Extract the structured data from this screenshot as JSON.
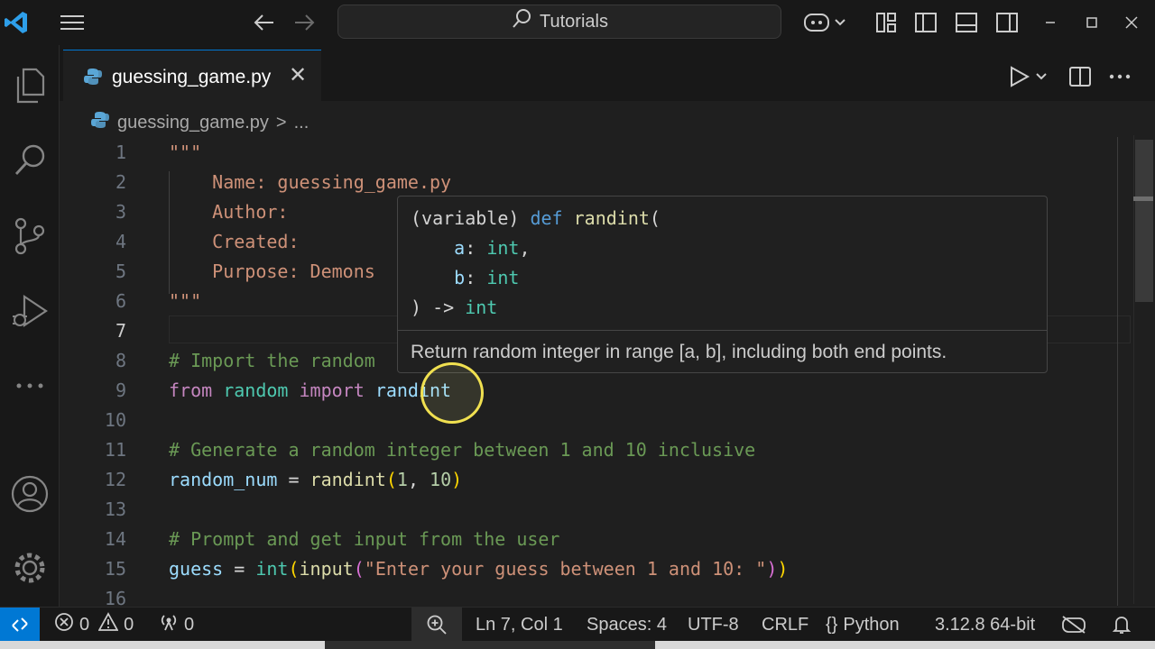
{
  "titlebar": {
    "search_label": "Tutorials",
    "icons": [
      "vscode-logo-icon",
      "menu-icon",
      "back-icon",
      "forward-icon",
      "copilot-icon",
      "layout-icon",
      "toggle-sidebar-icon",
      "toggle-panel-icon",
      "toggle-secondary-sidebar-icon",
      "minimize-icon",
      "maximize-icon",
      "close-icon"
    ]
  },
  "activitybar": {
    "items": [
      "explorer-icon",
      "search-icon",
      "source-control-icon",
      "run-debug-icon",
      "more-icon",
      "accounts-icon",
      "manage-gear-icon"
    ]
  },
  "tab": {
    "filename": "guessing_game.py",
    "close_glyph": "✕"
  },
  "breadcrumb": {
    "file": "guessing_game.py",
    "sep": ">",
    "rest": "..."
  },
  "editor": {
    "active_line": 7,
    "lines": [
      {
        "n": "1",
        "parts": [
          {
            "t": "\"\"\"",
            "c": "str"
          }
        ]
      },
      {
        "n": "2",
        "parts": [
          {
            "t": "    Name: guessing_game.py",
            "c": "str"
          }
        ]
      },
      {
        "n": "3",
        "parts": [
          {
            "t": "    Author:",
            "c": "str"
          }
        ]
      },
      {
        "n": "4",
        "parts": [
          {
            "t": "    Created:",
            "c": "str"
          }
        ]
      },
      {
        "n": "5",
        "parts": [
          {
            "t": "    Purpose: Demons",
            "c": "str"
          }
        ]
      },
      {
        "n": "6",
        "parts": [
          {
            "t": "\"\"\"",
            "c": "str"
          }
        ]
      },
      {
        "n": "7",
        "parts": []
      },
      {
        "n": "8",
        "parts": [
          {
            "t": "# Import the random",
            "c": "com"
          }
        ]
      },
      {
        "n": "9",
        "parts": [
          {
            "t": "from",
            "c": "kw"
          },
          {
            "t": " ",
            "c": "op"
          },
          {
            "t": "random",
            "c": "mod"
          },
          {
            "t": " ",
            "c": "op"
          },
          {
            "t": "import",
            "c": "kw"
          },
          {
            "t": " ",
            "c": "op"
          },
          {
            "t": "randint",
            "c": "var"
          }
        ]
      },
      {
        "n": "10",
        "parts": []
      },
      {
        "n": "11",
        "parts": [
          {
            "t": "# Generate a random integer between 1 and 10 inclusive",
            "c": "com"
          }
        ]
      },
      {
        "n": "12",
        "parts": [
          {
            "t": "random_num",
            "c": "var"
          },
          {
            "t": " = ",
            "c": "op"
          },
          {
            "t": "randint",
            "c": "fn"
          },
          {
            "t": "(",
            "c": "paren"
          },
          {
            "t": "1",
            "c": "num"
          },
          {
            "t": ", ",
            "c": "op"
          },
          {
            "t": "10",
            "c": "num"
          },
          {
            "t": ")",
            "c": "paren"
          }
        ]
      },
      {
        "n": "13",
        "parts": []
      },
      {
        "n": "14",
        "parts": [
          {
            "t": "# Prompt and get input from the user",
            "c": "com"
          }
        ]
      },
      {
        "n": "15",
        "parts": [
          {
            "t": "guess",
            "c": "var"
          },
          {
            "t": " = ",
            "c": "op"
          },
          {
            "t": "int",
            "c": "mod"
          },
          {
            "t": "(",
            "c": "paren"
          },
          {
            "t": "input",
            "c": "fn"
          },
          {
            "t": "(",
            "c": "paren2"
          },
          {
            "t": "\"Enter your guess between 1 and 10: \"",
            "c": "str"
          },
          {
            "t": ")",
            "c": "paren2"
          },
          {
            "t": ")",
            "c": "paren"
          }
        ]
      },
      {
        "n": "16",
        "parts": []
      }
    ]
  },
  "hover": {
    "signature_lines": [
      [
        {
          "t": "(variable) ",
          "c": "op"
        },
        {
          "t": "def",
          "c": "def"
        },
        {
          "t": " ",
          "c": "op"
        },
        {
          "t": "randint",
          "c": "fn"
        },
        {
          "t": "(",
          "c": "op"
        }
      ],
      [
        {
          "t": "    ",
          "c": "op"
        },
        {
          "t": "a",
          "c": "var"
        },
        {
          "t": ": ",
          "c": "op"
        },
        {
          "t": "int",
          "c": "mod"
        },
        {
          "t": ",",
          "c": "op"
        }
      ],
      [
        {
          "t": "    ",
          "c": "op"
        },
        {
          "t": "b",
          "c": "var"
        },
        {
          "t": ": ",
          "c": "op"
        },
        {
          "t": "int",
          "c": "mod"
        }
      ],
      [
        {
          "t": ") -> ",
          "c": "op"
        },
        {
          "t": "int",
          "c": "mod"
        }
      ]
    ],
    "doc": "Return random integer in range [a, b], including both end points."
  },
  "statusbar": {
    "errors": "0",
    "warnings": "0",
    "ports": "0",
    "position": "Ln 7, Col 1",
    "spaces": "Spaces: 4",
    "encoding": "UTF-8",
    "eol": "CRLF",
    "language_braces": "{}",
    "language": "Python",
    "interpreter": "3.12.8 64-bit"
  },
  "colors": {
    "accent": "#0078d4",
    "string": "#ce9178",
    "comment": "#6a9955",
    "keyword": "#c586c0",
    "cursor_ring": "#f0e050"
  }
}
